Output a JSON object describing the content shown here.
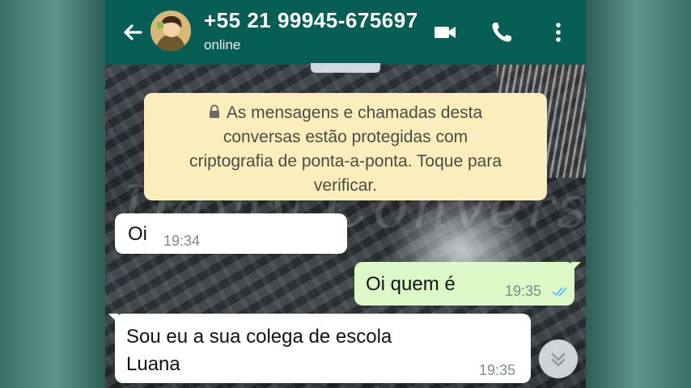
{
  "header": {
    "contact_number": "+55 21 99945-675697",
    "status": "online",
    "icons": [
      "back-arrow-icon",
      "video-call-icon",
      "phone-icon",
      "more-options-icon"
    ],
    "color": "#075e54"
  },
  "encryption_notice": {
    "lines": [
      "As mensagens e chamadas desta",
      "conversas estão protegidas com",
      "criptografia de ponta-a-ponta. Toque para",
      "verificar."
    ],
    "icon": "lock-icon"
  },
  "watermark": "Dayly Conversa",
  "messages": [
    {
      "direction": "incoming",
      "text": "Oi",
      "time": "19:34"
    },
    {
      "direction": "outgoing",
      "text": "Oi quem é",
      "time": "19:35",
      "status": "read"
    },
    {
      "direction": "incoming",
      "text_lines": [
        "Sou eu a sua colega de escola",
        "Luana"
      ],
      "time": "19:35"
    }
  ],
  "colors": {
    "outgoing_bubble": "#dcf8c6",
    "incoming_bubble": "#ffffff",
    "notice_bubble": "#fbeebc",
    "read_ticks": "#4fc3f7"
  }
}
